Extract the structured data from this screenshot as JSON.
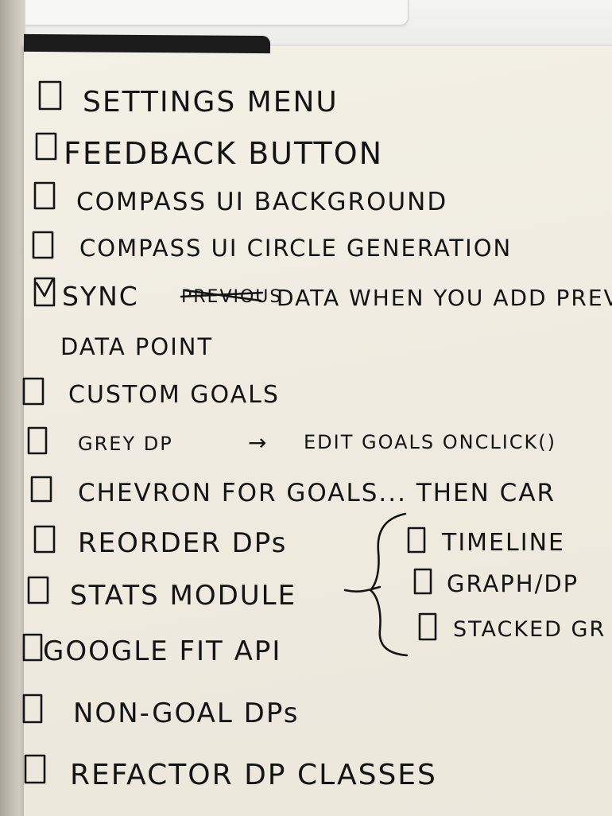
{
  "notebook": {
    "colors": {
      "paper": "#f1eee4",
      "ink": "#141414",
      "band": "#1b1b1b"
    },
    "items": [
      {
        "text": "SETTINGS MENU",
        "checked": false
      },
      {
        "text": "FEEDBACK BUTTON",
        "checked": false
      },
      {
        "text": "COMPASS UI BACKGROUND",
        "checked": false
      },
      {
        "text": "COMPASS UI CIRCLE GENERATION",
        "checked": false
      },
      {
        "text": "SYNC",
        "struck": "PREVIOUS",
        "rest": "DATA WHEN YOU ADD PREVIOUS",
        "checked": true
      },
      {
        "text": "DATA POINT"
      },
      {
        "text": "CUSTOM GOALS",
        "checked": false
      },
      {
        "text": "GREY DP",
        "arrow": "→",
        "rest": "EDIT GOALS ONCLICK()",
        "checked": false
      },
      {
        "text": "CHEVRON FOR GOALS... THEN CAR",
        "checked": false
      },
      {
        "text": "REORDER DPs",
        "checked": false
      },
      {
        "text": "STATS MODULE",
        "checked": false
      },
      {
        "text": "GOOGLE FIT API",
        "checked": false
      },
      {
        "text": "NON-GOAL DPs",
        "checked": false
      },
      {
        "text": "REFACTOR DP CLASSES",
        "checked": false
      }
    ],
    "stats_subitems": [
      {
        "text": "TIMELINE",
        "checked": false
      },
      {
        "text": "GRAPH/DP",
        "checked": false
      },
      {
        "text": "STACKED GR",
        "checked": false
      }
    ]
  }
}
